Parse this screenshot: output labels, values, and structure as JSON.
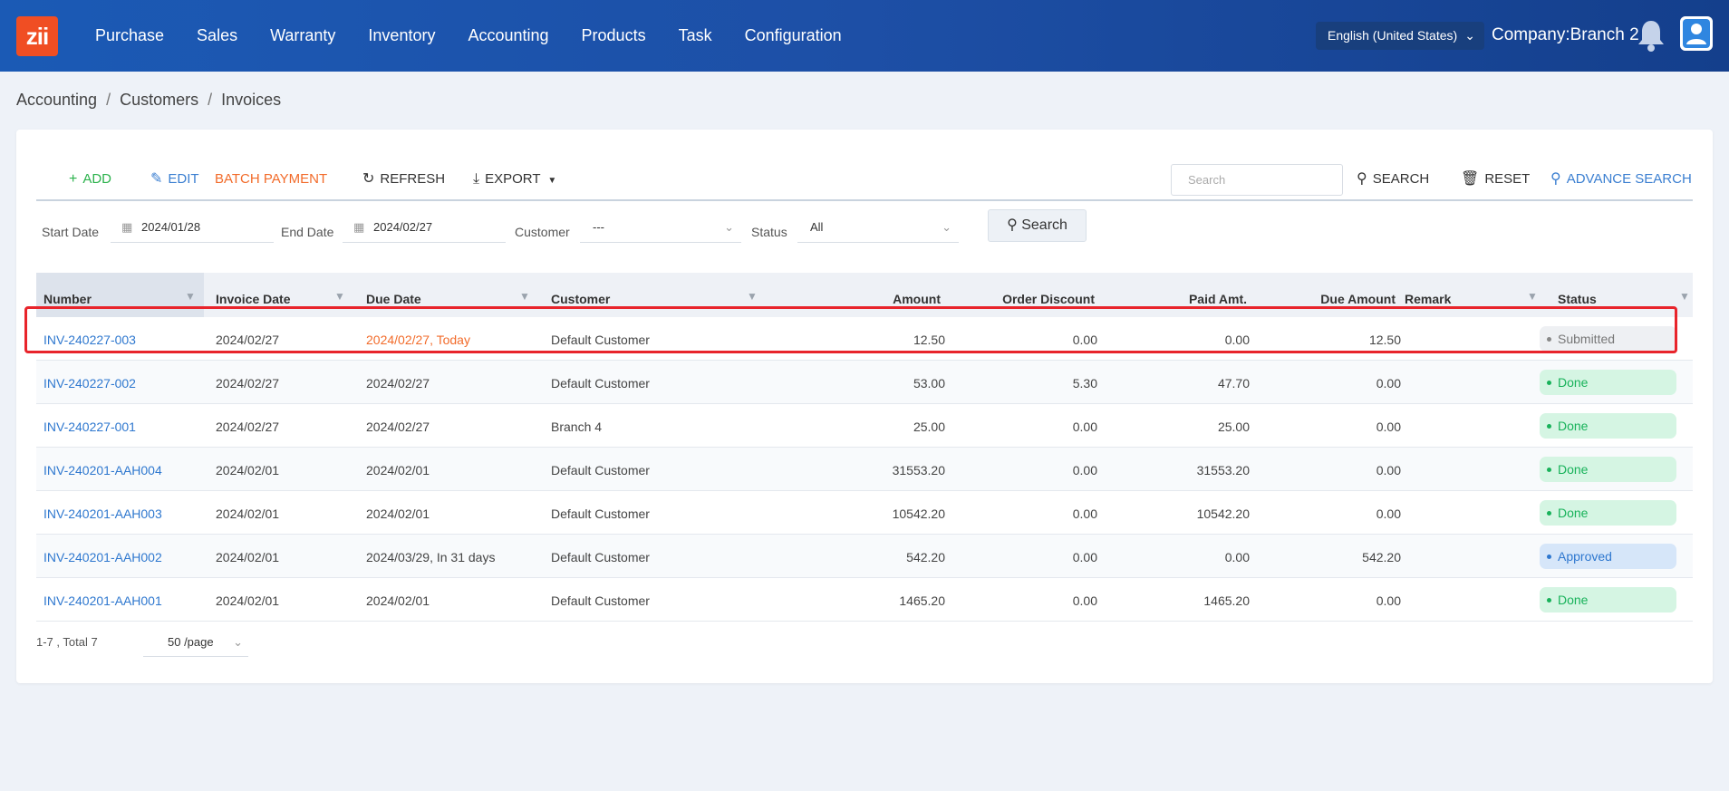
{
  "nav": {
    "logo": "zii",
    "items": [
      "Purchase",
      "Sales",
      "Warranty",
      "Inventory",
      "Accounting",
      "Products",
      "Task",
      "Configuration"
    ],
    "language": "English (United States)",
    "company": "Company:Branch 2"
  },
  "breadcrumb": [
    "Accounting",
    "Customers",
    "Invoices"
  ],
  "toolbar": {
    "add": "ADD",
    "edit": "EDIT",
    "batch_payment": "BATCH PAYMENT",
    "refresh": "REFRESH",
    "export": "EXPORT",
    "search_placeholder": "Search",
    "search": "SEARCH",
    "reset": "RESET",
    "advance_search": "ADVANCE SEARCH"
  },
  "filters": {
    "start_date_label": "Start Date",
    "start_date": "2024/01/28",
    "end_date_label": "End Date",
    "end_date": "2024/02/27",
    "customer_label": "Customer",
    "customer": "---",
    "status_label": "Status",
    "status": "All",
    "search_button": "Search"
  },
  "table": {
    "columns": [
      "Number",
      "Invoice Date",
      "Due Date",
      "Customer",
      "Amount",
      "Order Discount",
      "Paid Amt.",
      "Due Amount",
      "Remark",
      "Status"
    ],
    "rows": [
      {
        "number": "INV-240227-003",
        "invoice_date": "2024/02/27",
        "due_date": "2024/02/27, Today",
        "customer": "Default Customer",
        "amount": "12.50",
        "discount": "0.00",
        "paid": "0.00",
        "due": "12.50",
        "remark": "",
        "status": "Submitted"
      },
      {
        "number": "INV-240227-002",
        "invoice_date": "2024/02/27",
        "due_date": "2024/02/27",
        "customer": "Default Customer",
        "amount": "53.00",
        "discount": "5.30",
        "paid": "47.70",
        "due": "0.00",
        "remark": "",
        "status": "Done"
      },
      {
        "number": "INV-240227-001",
        "invoice_date": "2024/02/27",
        "due_date": "2024/02/27",
        "customer": "Branch 4",
        "amount": "25.00",
        "discount": "0.00",
        "paid": "25.00",
        "due": "0.00",
        "remark": "",
        "status": "Done"
      },
      {
        "number": "INV-240201-AAH004",
        "invoice_date": "2024/02/01",
        "due_date": "2024/02/01",
        "customer": "Default Customer",
        "amount": "31553.20",
        "discount": "0.00",
        "paid": "31553.20",
        "due": "0.00",
        "remark": "",
        "status": "Done"
      },
      {
        "number": "INV-240201-AAH003",
        "invoice_date": "2024/02/01",
        "due_date": "2024/02/01",
        "customer": "Default Customer",
        "amount": "10542.20",
        "discount": "0.00",
        "paid": "10542.20",
        "due": "0.00",
        "remark": "",
        "status": "Done"
      },
      {
        "number": "INV-240201-AAH002",
        "invoice_date": "2024/02/01",
        "due_date": "2024/03/29, In 31 days",
        "customer": "Default Customer",
        "amount": "542.20",
        "discount": "0.00",
        "paid": "0.00",
        "due": "542.20",
        "remark": "",
        "status": "Approved"
      },
      {
        "number": "INV-240201-AAH001",
        "invoice_date": "2024/02/01",
        "due_date": "2024/02/01",
        "customer": "Default Customer",
        "amount": "1465.20",
        "discount": "0.00",
        "paid": "1465.20",
        "due": "0.00",
        "remark": "",
        "status": "Done"
      }
    ]
  },
  "pager": {
    "summary": "1-7 , Total 7",
    "per_page": "50 /page"
  },
  "colors": {
    "nav_bg": "#1b5ab5",
    "accent_orange": "#f26b2a",
    "link_blue": "#2f78cf",
    "highlight_red": "#e8242b"
  }
}
